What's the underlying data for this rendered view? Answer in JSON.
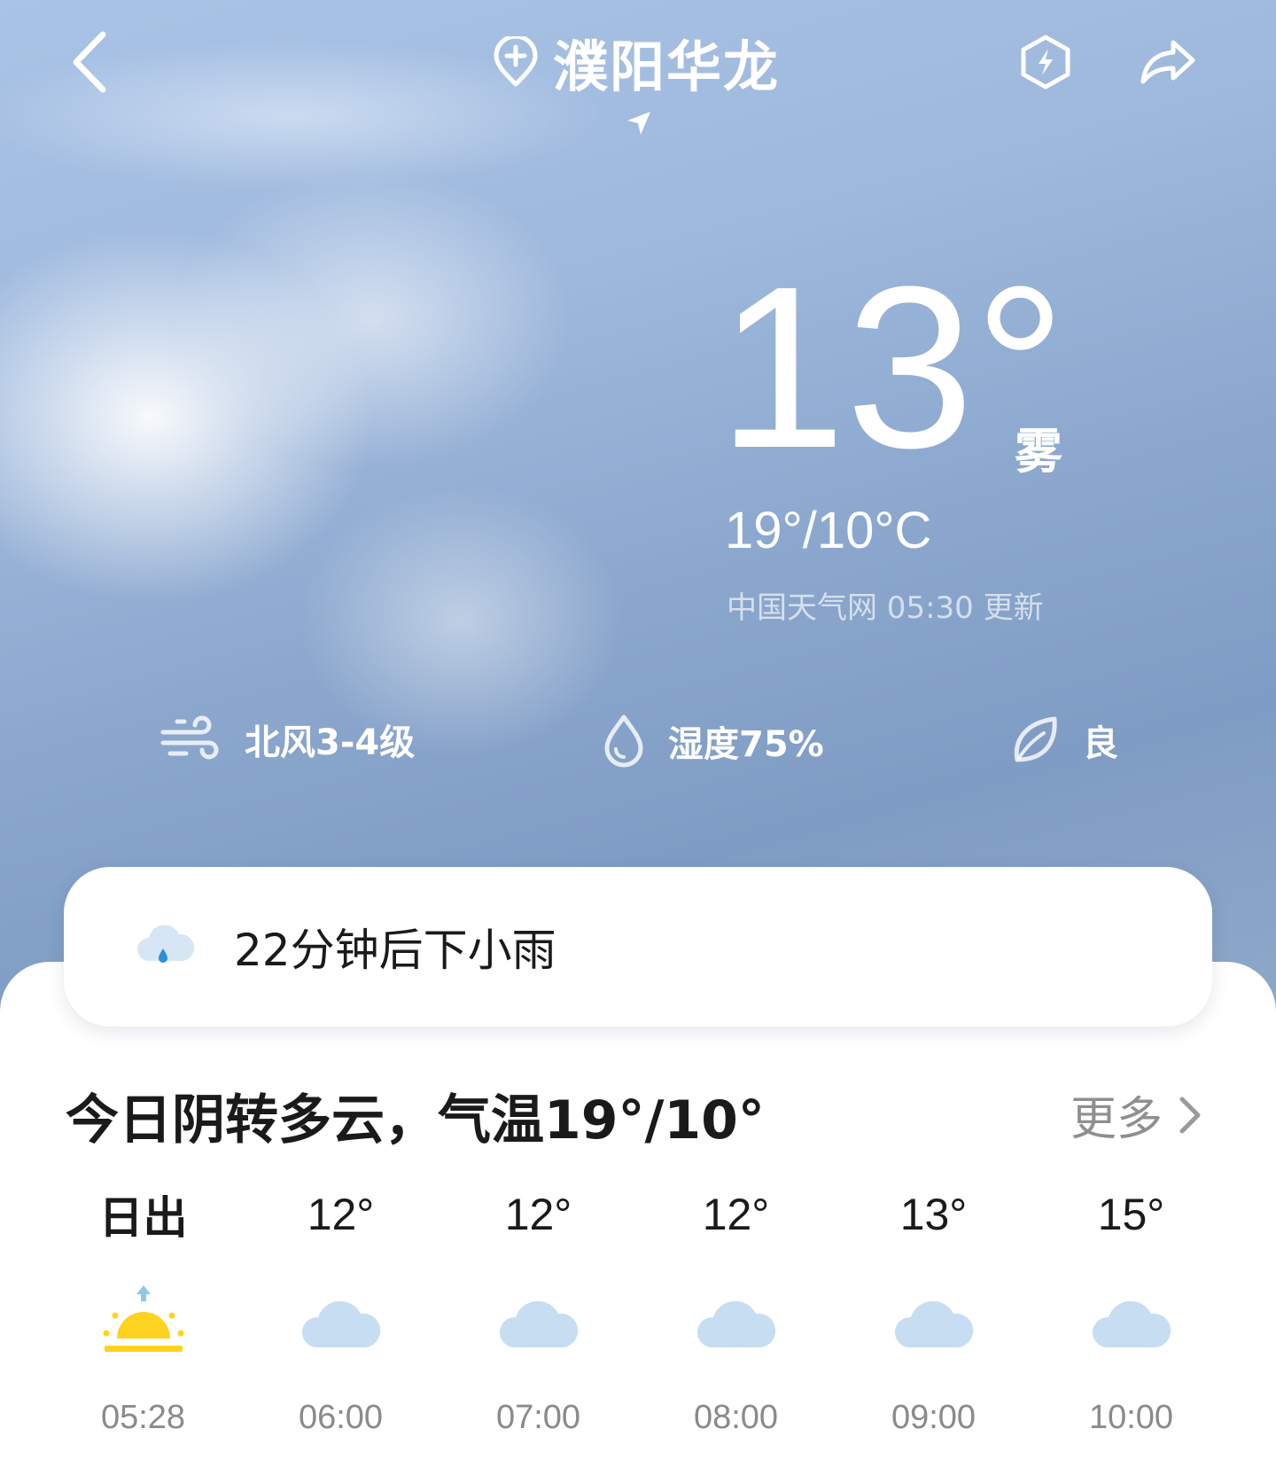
{
  "header": {
    "title": "濮阳华龙",
    "icons": [
      "chevron-left-icon",
      "add-location-icon",
      "navigation-arrow-icon",
      "bolt-hexagon-icon",
      "share-icon"
    ]
  },
  "current": {
    "temperature": "13°",
    "condition": "雾",
    "range": "19°/10°C",
    "source": "中国天气网 05:30 更新"
  },
  "stats": {
    "wind": "北风3-4级",
    "humidity": "湿度75%",
    "air_quality": "良"
  },
  "alert": {
    "text": "22分钟后下小雨",
    "icon": "rain-cloud-icon"
  },
  "today": {
    "summary": "今日阴转多云，气温19°/10°",
    "more_label": "更多"
  },
  "hourly": [
    {
      "top": "日出",
      "time": "05:28",
      "icon": "sunrise-icon"
    },
    {
      "top": "12°",
      "time": "06:00",
      "icon": "cloud-icon"
    },
    {
      "top": "12°",
      "time": "07:00",
      "icon": "cloud-icon"
    },
    {
      "top": "12°",
      "time": "08:00",
      "icon": "cloud-icon"
    },
    {
      "top": "13°",
      "time": "09:00",
      "icon": "cloud-icon"
    },
    {
      "top": "15°",
      "time": "10:00",
      "icon": "cloud-icon"
    }
  ],
  "colors": {
    "sky_top": "#a9c3e6",
    "sky_bottom": "#7f9cc4",
    "sun": "#ffd21f",
    "cloud": "#c7ddf2",
    "rain_drop": "#2b8fe0"
  }
}
